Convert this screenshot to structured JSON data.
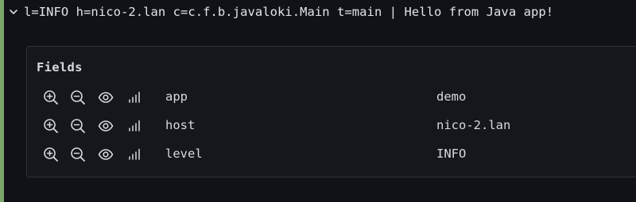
{
  "log": {
    "line": "l=INFO h=nico-2.lan c=c.f.b.javaloki.Main t=main | Hello from Java app!"
  },
  "fields": {
    "title": "Fields",
    "rows": [
      {
        "key": "app",
        "value": "demo"
      },
      {
        "key": "host",
        "value": "nico-2.lan"
      },
      {
        "key": "level",
        "value": "INFO"
      }
    ]
  },
  "colors": {
    "background": "#111217",
    "accent_bar": "#7aa66a",
    "panel_border": "#2f3138",
    "text": "#d8d9de"
  },
  "icons": {
    "expand": "chevron-down-icon",
    "filter_for": "zoom-in-icon",
    "filter_out": "zoom-out-icon",
    "toggle": "eye-icon",
    "stats": "signal-bars-icon"
  }
}
